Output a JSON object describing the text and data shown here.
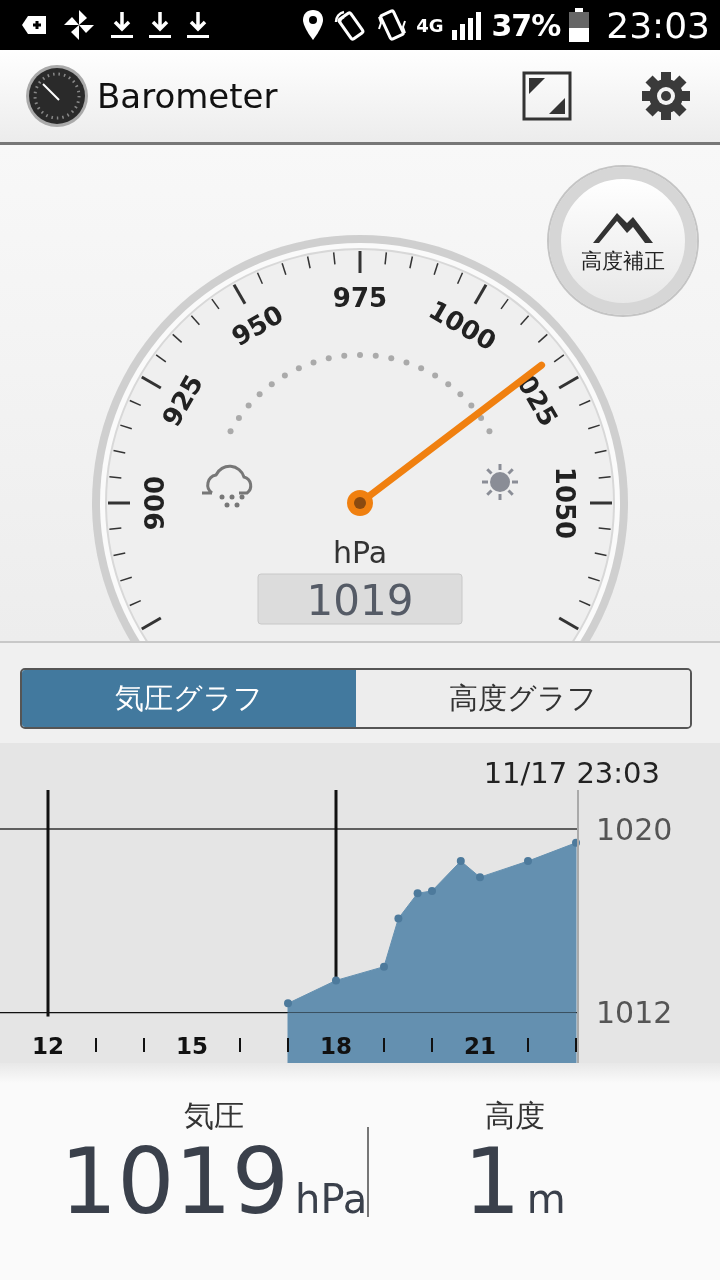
{
  "status_bar": {
    "network": "4G",
    "battery": "37%",
    "time": "23:03"
  },
  "app_bar": {
    "title": "Barometer"
  },
  "gauge": {
    "scale_labels": [
      "900",
      "925",
      "950",
      "975",
      "1000",
      "025",
      "1050"
    ],
    "unit": "hPa",
    "reading": "1019"
  },
  "altitude_button": {
    "label": "高度補正"
  },
  "tabs": [
    {
      "label": "気圧グラフ",
      "selected": true
    },
    {
      "label": "高度グラフ",
      "selected": false
    }
  ],
  "graph": {
    "timestamp": "11/17 23:03",
    "chart_data": {
      "type": "area",
      "x": [
        17,
        18,
        19,
        19.3,
        19.7,
        20,
        20.6,
        21,
        22,
        23
      ],
      "series": [
        {
          "color": "#6490b0",
          "values": [
            1012.4,
            1013.4,
            1014.0,
            1016.1,
            1017.2,
            1017.3,
            1018.6,
            1017.9,
            1018.6,
            1019.4
          ]
        }
      ],
      "xlim": [
        11,
        26
      ],
      "ylim": [
        1009.8,
        1021.7
      ],
      "xticks": [
        12,
        15,
        18,
        21
      ],
      "yticks": [
        1012,
        1020
      ],
      "grid": true
    }
  },
  "summary": [
    {
      "label": "気圧",
      "value": "1019",
      "unit": "hPa"
    },
    {
      "label": "高度",
      "value": "1",
      "unit": "m"
    }
  ]
}
